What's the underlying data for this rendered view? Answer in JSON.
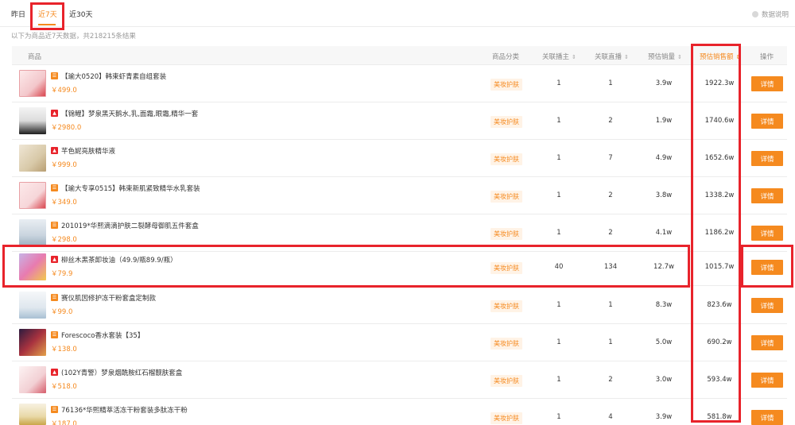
{
  "tabs": [
    {
      "label": "昨日"
    },
    {
      "label": "近7天"
    },
    {
      "label": "近30天"
    }
  ],
  "explain_label": "数据说明",
  "note": "以下为商品近7天数据，共218215条结果",
  "columns": {
    "product": "商品",
    "category": "商品分类",
    "anchors": "关联播主",
    "lives": "关联直播",
    "est_volume": "预估销量",
    "est_amount": "预估销售额",
    "action": "操作"
  },
  "sort_glyph": "⇕",
  "rows": [
    {
      "name": "【瑜大0520】韩束虾青素自组套装",
      "price": "￥499.0",
      "category": "美妆护肤",
      "anchors": "1",
      "lives": "1",
      "volume": "3.9w",
      "amount": "1922.3w",
      "action": "详情"
    },
    {
      "name": "【锦鲤】梦泉黑天鹅水,乳,面霜,眼霜,精华一套",
      "price": "￥2980.0",
      "category": "美妆护肤",
      "anchors": "1",
      "lives": "2",
      "volume": "1.9w",
      "amount": "1740.6w",
      "action": "详情"
    },
    {
      "name": "芊色妮亮肤精华液",
      "price": "￥999.0",
      "category": "美妆护肤",
      "anchors": "1",
      "lives": "7",
      "volume": "4.9w",
      "amount": "1652.6w",
      "action": "详情"
    },
    {
      "name": "【瑜大专享0515】韩束新肌紧致精华水乳套装",
      "price": "￥349.0",
      "category": "美妆护肤",
      "anchors": "1",
      "lives": "2",
      "volume": "3.8w",
      "amount": "1338.2w",
      "action": "详情"
    },
    {
      "name": "201019*华熙滴滴护肤二裂酵母御肌五件套盒",
      "price": "￥298.0",
      "category": "美妆护肤",
      "anchors": "1",
      "lives": "2",
      "volume": "4.1w",
      "amount": "1186.2w",
      "action": "详情"
    },
    {
      "name": "柳丝木黑茶卸妆油（49.9/瓶89.9/瓶）",
      "price": "￥79.9",
      "category": "美妆护肤",
      "anchors": "40",
      "lives": "134",
      "volume": "12.7w",
      "amount": "1015.7w",
      "action": "详情"
    },
    {
      "name": "赛仪肌因修护冻干粉套盒定制款",
      "price": "￥99.0",
      "category": "美妆护肤",
      "anchors": "1",
      "lives": "1",
      "volume": "8.3w",
      "amount": "823.6w",
      "action": "详情"
    },
    {
      "name": "Forescoco香水套装【35】",
      "price": "￥138.0",
      "category": "美妆护肤",
      "anchors": "1",
      "lives": "1",
      "volume": "5.0w",
      "amount": "690.2w",
      "action": "详情"
    },
    {
      "name": "(102Y青警）梦泉烟酰胺红石榴靓肤套盒",
      "price": "￥518.0",
      "category": "美妆护肤",
      "anchors": "1",
      "lives": "2",
      "volume": "3.0w",
      "amount": "593.4w",
      "action": "详情"
    },
    {
      "name": "76136*华熙精萃活冻干粉套装多肽冻干粉",
      "price": "￥187.0",
      "category": "美妆护肤",
      "anchors": "1",
      "lives": "4",
      "volume": "3.9w",
      "amount": "581.8w",
      "action": "详情"
    }
  ],
  "colors": {
    "accent": "#f5891e",
    "highlight": "#e8232b",
    "tag_bg": "#fff3e6"
  }
}
